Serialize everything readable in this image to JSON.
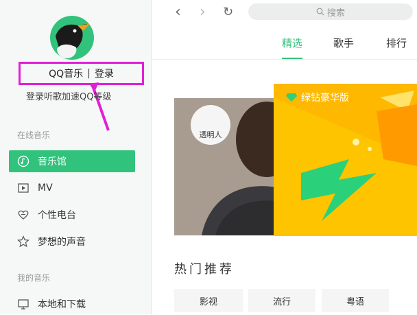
{
  "user": {
    "app_name": "QQ音乐",
    "separator": "|",
    "login_label": "登录",
    "login_hint": "登录听歌加速QQ等级"
  },
  "sidebar": {
    "online_section": "在线音乐",
    "online_items": [
      {
        "label": "音乐馆",
        "icon": "music-hall-icon",
        "active": true
      },
      {
        "label": "MV",
        "icon": "mv-icon",
        "active": false
      },
      {
        "label": "个性电台",
        "icon": "radio-heart-icon",
        "active": false
      },
      {
        "label": "梦想的声音",
        "icon": "star-icon",
        "active": false
      }
    ],
    "my_section": "我的音乐",
    "my_items": [
      {
        "label": "本地和下载",
        "icon": "monitor-icon"
      }
    ]
  },
  "topbar": {
    "back_glyph": "‹",
    "forward_glyph": "›",
    "refresh_glyph": "↻",
    "search_placeholder": "搜索"
  },
  "tabs": [
    {
      "label": "精选",
      "active": true
    },
    {
      "label": "歌手",
      "active": false
    },
    {
      "label": "排行",
      "active": false
    }
  ],
  "banner": {
    "promo_label": "绿钻豪华版",
    "badge_text": "透明人"
  },
  "hot": {
    "title": "热门推荐",
    "genres": [
      "影视",
      "流行",
      "粤语"
    ]
  },
  "colors": {
    "accent": "#31c27c",
    "highlight_box": "#e020d8",
    "promo_yellow": "#ffc000"
  }
}
